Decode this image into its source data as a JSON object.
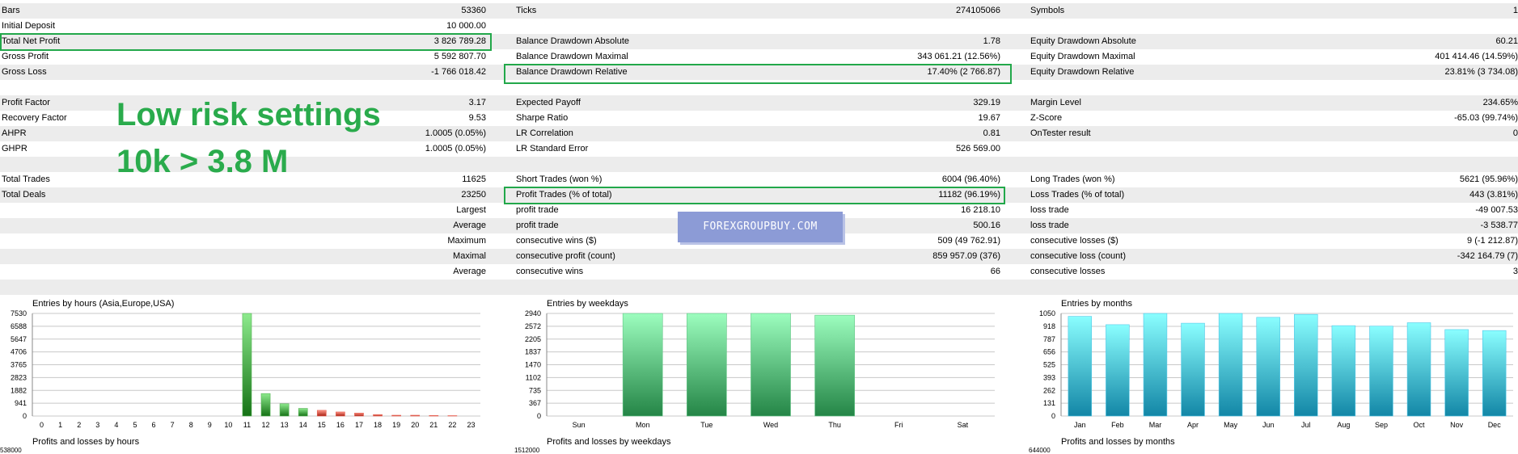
{
  "stats": {
    "rows": [
      {
        "shade": true,
        "cells": [
          [
            "Bars",
            "53360"
          ],
          [
            "Ticks",
            "274105066"
          ],
          [
            "Symbols",
            "1"
          ]
        ]
      },
      {
        "shade": false,
        "cells": [
          [
            "Initial Deposit",
            "10 000.00"
          ],
          [
            "",
            ""
          ],
          [
            "",
            ""
          ]
        ]
      },
      {
        "shade": true,
        "cells": [
          [
            "Total Net Profit",
            "3 826 789.28"
          ],
          [
            "Balance Drawdown Absolute",
            "1.78"
          ],
          [
            "Equity Drawdown Absolute",
            "60.21"
          ]
        ]
      },
      {
        "shade": false,
        "cells": [
          [
            "Gross Profit",
            "5 592 807.70"
          ],
          [
            "Balance Drawdown Maximal",
            "343 061.21 (12.56%)"
          ],
          [
            "Equity Drawdown Maximal",
            "401 414.46 (14.59%)"
          ]
        ]
      },
      {
        "shade": true,
        "cells": [
          [
            "Gross Loss",
            "-1 766 018.42"
          ],
          [
            "Balance Drawdown Relative",
            "17.40% (2 766.87)"
          ],
          [
            "Equity Drawdown Relative",
            "23.81% (3 734.08)"
          ]
        ]
      },
      {
        "shade": false,
        "cells": [
          [
            "",
            ""
          ],
          [
            "",
            ""
          ],
          [
            "",
            ""
          ]
        ]
      },
      {
        "shade": true,
        "cells": [
          [
            "Profit Factor",
            "3.17"
          ],
          [
            "Expected Payoff",
            "329.19"
          ],
          [
            "Margin Level",
            "234.65%"
          ]
        ]
      },
      {
        "shade": false,
        "cells": [
          [
            "Recovery Factor",
            "9.53"
          ],
          [
            "Sharpe Ratio",
            "19.67"
          ],
          [
            "Z-Score",
            "-65.03 (99.74%)"
          ]
        ]
      },
      {
        "shade": true,
        "cells": [
          [
            "AHPR",
            "1.0005 (0.05%)"
          ],
          [
            "LR Correlation",
            "0.81"
          ],
          [
            "OnTester result",
            "0"
          ]
        ]
      },
      {
        "shade": false,
        "cells": [
          [
            "GHPR",
            "1.0005 (0.05%)"
          ],
          [
            "LR Standard Error",
            "526 569.00"
          ],
          [
            "",
            ""
          ]
        ]
      },
      {
        "shade": true,
        "cells": [
          [
            "",
            ""
          ],
          [
            "",
            ""
          ],
          [
            "",
            ""
          ]
        ]
      },
      {
        "shade": false,
        "cells": [
          [
            "Total Trades",
            "11625"
          ],
          [
            "Short Trades (won %)",
            "6004 (96.40%)"
          ],
          [
            "Long Trades (won %)",
            "5621 (95.96%)"
          ]
        ]
      },
      {
        "shade": true,
        "cells": [
          [
            "Total Deals",
            "23250"
          ],
          [
            "Profit Trades (% of total)",
            "11182 (96.19%)"
          ],
          [
            "Loss Trades (% of total)",
            "443 (3.81%)"
          ]
        ]
      }
    ],
    "trade_rows": [
      {
        "shade": false,
        "label": "Largest",
        "cells": [
          [
            "profit trade",
            "16 218.10"
          ],
          [
            "loss trade",
            "-49 007.53"
          ]
        ]
      },
      {
        "shade": true,
        "label": "Average",
        "cells": [
          [
            "profit trade",
            "500.16"
          ],
          [
            "loss trade",
            "-3 538.77"
          ]
        ]
      },
      {
        "shade": false,
        "label": "Maximum",
        "cells": [
          [
            "consecutive wins ($)",
            "509 (49 762.91)"
          ],
          [
            "consecutive losses ($)",
            "9 (-1 212.87)"
          ]
        ]
      },
      {
        "shade": true,
        "label": "Maximal",
        "cells": [
          [
            "consecutive profit (count)",
            "859 957.09 (376)"
          ],
          [
            "consecutive loss (count)",
            "-342 164.79 (7)"
          ]
        ]
      },
      {
        "shade": false,
        "label": "Average",
        "cells": [
          [
            "consecutive wins",
            "66"
          ],
          [
            "consecutive losses",
            "3"
          ]
        ]
      },
      {
        "shade": true,
        "label": "",
        "cells": [
          [
            "",
            ""
          ],
          [
            "",
            ""
          ]
        ]
      }
    ]
  },
  "overlay": {
    "line1": "Low risk settings",
    "line2": "10k > 3.8 M"
  },
  "watermark": "FOREXGROUPBUY.COM",
  "colors": {
    "highlight": "#22a84a",
    "overlay_text": "#2aab4c",
    "watermark_bg": "#8c9bd6",
    "row_shade": "#ececec"
  },
  "chart_data": [
    {
      "type": "bar",
      "title": "Entries by hours (Asia,Europe,USA)",
      "categories": [
        "0",
        "1",
        "2",
        "3",
        "4",
        "5",
        "6",
        "7",
        "8",
        "9",
        "10",
        "11",
        "12",
        "13",
        "14",
        "15",
        "16",
        "17",
        "18",
        "19",
        "20",
        "21",
        "22",
        "23"
      ],
      "series": [
        {
          "color": "#2e8b2e",
          "values": [
            0,
            0,
            0,
            0,
            0,
            0,
            0,
            0,
            0,
            0,
            0,
            7530,
            1650,
            900,
            560,
            0,
            0,
            0,
            0,
            0,
            0,
            0,
            0,
            0
          ]
        },
        {
          "color": "#c0392b",
          "values": [
            0,
            0,
            0,
            0,
            0,
            0,
            0,
            0,
            0,
            0,
            0,
            0,
            0,
            0,
            0,
            420,
            300,
            220,
            110,
            60,
            60,
            40,
            30,
            0
          ]
        }
      ],
      "yticks": [
        "0",
        "941",
        "1882",
        "2823",
        "3765",
        "4706",
        "5647",
        "6588",
        "7530"
      ],
      "ylim": [
        0,
        7530
      ]
    },
    {
      "type": "bar",
      "title": "Entries by weekdays",
      "categories": [
        "Sun",
        "Mon",
        "Tue",
        "Wed",
        "Thu",
        "Fri",
        "Sat"
      ],
      "series": [
        {
          "color": "#3d9e5f",
          "values": [
            0,
            2940,
            2940,
            2940,
            2890,
            0,
            0
          ]
        }
      ],
      "yticks": [
        "0",
        "367",
        "735",
        "1102",
        "1470",
        "1837",
        "2205",
        "2572",
        "2940"
      ],
      "ylim": [
        0,
        2940
      ]
    },
    {
      "type": "bar",
      "title": "Entries by months",
      "categories": [
        "Jan",
        "Feb",
        "Mar",
        "Apr",
        "May",
        "Jun",
        "Jul",
        "Aug",
        "Sep",
        "Oct",
        "Nov",
        "Dec"
      ],
      "series": [
        {
          "color": "#2b9fbf",
          "values": [
            1020,
            935,
            1050,
            950,
            1050,
            1010,
            1040,
            925,
            920,
            955,
            885,
            875
          ]
        }
      ],
      "yticks": [
        "0",
        "131",
        "262",
        "393",
        "525",
        "656",
        "787",
        "918",
        "1050"
      ],
      "ylim": [
        0,
        1050
      ]
    }
  ],
  "bottom_charts": [
    {
      "title": "Profits and losses by hours",
      "ytop": "538000"
    },
    {
      "title": "Profits and losses by weekdays",
      "ytop": "1512000"
    },
    {
      "title": "Profits and losses by months",
      "ytop": "644000"
    }
  ]
}
